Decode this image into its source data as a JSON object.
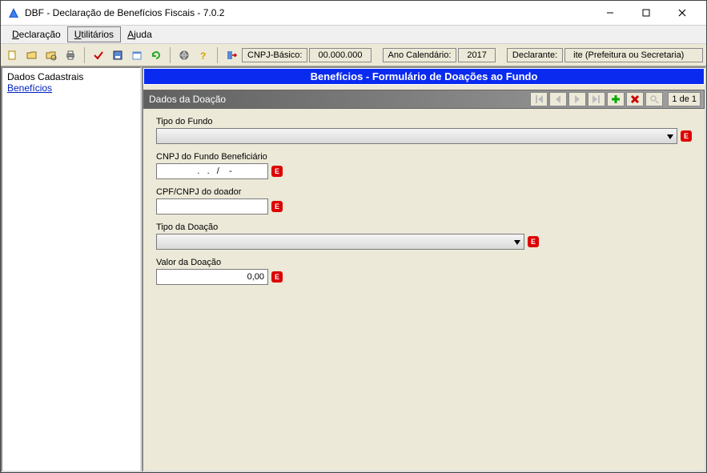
{
  "window": {
    "title": "DBF - Declaração de Benefícios Fiscais - 7.0.2"
  },
  "menu": {
    "declaracao": "Declaração",
    "declaracao_ul": "D",
    "utilitarios": "Utilitários",
    "utilitarios_ul": "U",
    "ajuda": "Ajuda",
    "ajuda_ul": "A"
  },
  "toolbar": {
    "cnpj_label": "CNPJ-Básico:",
    "cnpj_value": "00.000.000",
    "ano_label": "Ano Calendário:",
    "ano_value": "2017",
    "declarante_label": "Declarante:",
    "declarante_value": "ite (Prefeitura ou Secretaria)"
  },
  "sidebar": {
    "item_dados": "Dados Cadastrais",
    "item_beneficios": "Benefícios "
  },
  "panel": {
    "title": "Benefícios - Formulário de Doações ao Fundo",
    "section_title": "Dados da Doação",
    "counter": "1 de 1"
  },
  "form": {
    "tipo_fundo_label": "Tipo do Fundo",
    "cnpj_fundo_label": "CNPJ do Fundo Beneficiário",
    "cnpj_fundo_value": "  .   .   /    -",
    "cpf_cnpj_doador_label": "CPF/CNPJ do doador",
    "cpf_cnpj_doador_value": "",
    "tipo_doacao_label": "Tipo da Doação",
    "valor_doacao_label": "Valor da Doação",
    "valor_doacao_value": "0,00",
    "error_badge": "E"
  }
}
